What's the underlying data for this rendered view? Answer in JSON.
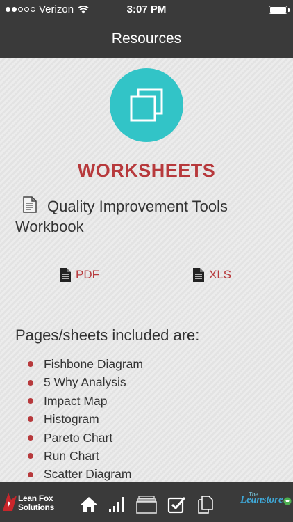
{
  "status_bar": {
    "carrier": "Verizon",
    "signal_bars_filled": 2,
    "signal_bars_total": 5,
    "time": "3:07 PM",
    "battery_level": 1.0
  },
  "nav": {
    "title": "Resources"
  },
  "hero": {
    "icon": "copy-squares-icon",
    "color": "#32c4c7"
  },
  "section_title": "WORKSHEETS",
  "document": {
    "icon": "document-icon",
    "title": "Quality Improvement Tools Workbook"
  },
  "downloads": [
    {
      "label": "PDF",
      "icon": "file-text-icon"
    },
    {
      "label": "XLS",
      "icon": "file-text-icon"
    }
  ],
  "list_heading": "Pages/sheets included are:",
  "pages": [
    "Fishbone Diagram",
    "5 Why Analysis",
    "Impact Map",
    "Histogram",
    "Pareto Chart",
    "Run Chart",
    "Scatter Diagram"
  ],
  "tab_bar": {
    "logo_left": {
      "line1": "Lean Fox",
      "line2": "Solutions"
    },
    "tabs": [
      "home-icon",
      "bar-chart-icon",
      "stacked-cards-icon",
      "checkbox-icon",
      "documents-icon"
    ],
    "logo_right": {
      "prefix": "The",
      "name": "Leanstore"
    }
  },
  "colors": {
    "accent_red": "#b7393c",
    "bar_dark": "#3a3a3a",
    "teal": "#32c4c7"
  }
}
